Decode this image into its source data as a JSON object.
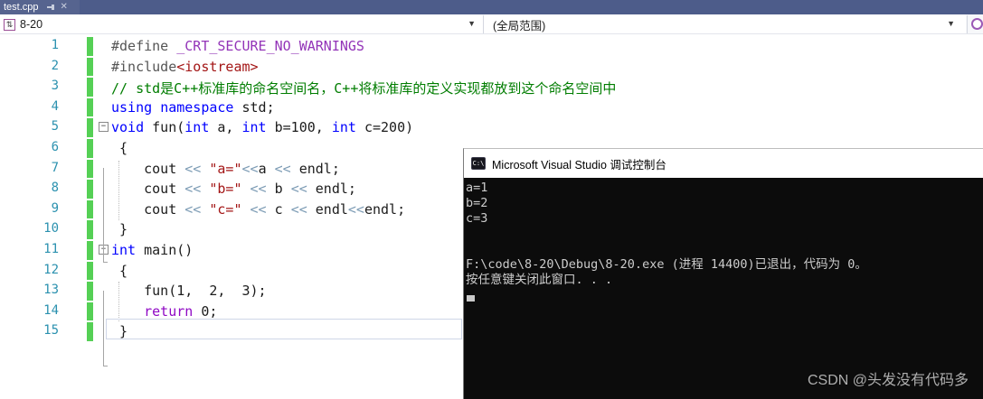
{
  "colors": {
    "tabstrip": "#4d5c8a",
    "tab_active": "#56648f",
    "nav_bg": "#f7f8fa",
    "line_number": "#2b91af",
    "change_bar_green": "#55d055",
    "keyword_blue": "#0000ff",
    "macro_purple": "#9334b8",
    "string_red": "#a31515",
    "comment_green": "#007d00",
    "operator_slate": "#7d9cb5",
    "control_purple": "#8f08c4",
    "console_bg": "#0c0c0c",
    "console_text": "#cccccc"
  },
  "tabstrip": {
    "tab_title": "test.cpp",
    "close_label": "✕"
  },
  "navbar": {
    "project_scope": "8-20",
    "member_scope": "(全局范围)",
    "arrow": "▼"
  },
  "editor": {
    "lines": [
      {
        "num": 1,
        "fold": false,
        "tokens": [
          [
            "d",
            "#define "
          ],
          [
            "m",
            "_CRT_SECURE_NO_WARNINGS"
          ]
        ]
      },
      {
        "num": 2,
        "fold": false,
        "tokens": [
          [
            "d",
            "#include"
          ],
          [
            "s",
            "<iostream>"
          ]
        ]
      },
      {
        "num": 3,
        "fold": false,
        "tokens": [
          [
            "c",
            "// std是C++标准库的命名空间名，C++将标准库的定义实现都放到这个命名空间中"
          ]
        ]
      },
      {
        "num": 4,
        "fold": false,
        "tokens": [
          [
            "k",
            "using"
          ],
          [
            "p",
            " "
          ],
          [
            "k",
            "namespace"
          ],
          [
            "p",
            " std;"
          ]
        ]
      },
      {
        "num": 5,
        "fold": true,
        "tokens": [
          [
            "k",
            "void"
          ],
          [
            "p",
            " fun("
          ],
          [
            "k",
            "int"
          ],
          [
            "p",
            " a, "
          ],
          [
            "k",
            "int"
          ],
          [
            "p",
            " b=100, "
          ],
          [
            "k",
            "int"
          ],
          [
            "p",
            " c=200)"
          ]
        ]
      },
      {
        "num": 6,
        "fold": false,
        "tokens": [
          [
            "p",
            " {"
          ]
        ]
      },
      {
        "num": 7,
        "fold": false,
        "tokens": [
          [
            "p",
            "    cout "
          ],
          [
            "o",
            "<<"
          ],
          [
            "p",
            " "
          ],
          [
            "s",
            "\"a=\""
          ],
          [
            "o",
            "<<"
          ],
          [
            "p",
            "a "
          ],
          [
            "o",
            "<<"
          ],
          [
            "p",
            " endl;"
          ]
        ]
      },
      {
        "num": 8,
        "fold": false,
        "tokens": [
          [
            "p",
            "    cout "
          ],
          [
            "o",
            "<<"
          ],
          [
            "p",
            " "
          ],
          [
            "s",
            "\"b=\""
          ],
          [
            "p",
            " "
          ],
          [
            "o",
            "<<"
          ],
          [
            "p",
            " b "
          ],
          [
            "o",
            "<<"
          ],
          [
            "p",
            " endl;"
          ]
        ]
      },
      {
        "num": 9,
        "fold": false,
        "tokens": [
          [
            "p",
            "    cout "
          ],
          [
            "o",
            "<<"
          ],
          [
            "p",
            " "
          ],
          [
            "s",
            "\"c=\""
          ],
          [
            "p",
            " "
          ],
          [
            "o",
            "<<"
          ],
          [
            "p",
            " c "
          ],
          [
            "o",
            "<<"
          ],
          [
            "p",
            " endl"
          ],
          [
            "o",
            "<<"
          ],
          [
            "p",
            "endl;"
          ]
        ]
      },
      {
        "num": 10,
        "fold": false,
        "tokens": [
          [
            "p",
            " }"
          ]
        ]
      },
      {
        "num": 11,
        "fold": true,
        "tokens": [
          [
            "k",
            "int"
          ],
          [
            "p",
            " main()"
          ]
        ]
      },
      {
        "num": 12,
        "fold": false,
        "tokens": [
          [
            "p",
            " {"
          ]
        ]
      },
      {
        "num": 13,
        "fold": false,
        "tokens": [
          [
            "p",
            "    fun(1,  2,  3);"
          ]
        ]
      },
      {
        "num": 14,
        "fold": false,
        "tokens": [
          [
            "p",
            "    "
          ],
          [
            "r",
            "return"
          ],
          [
            "p",
            " 0;"
          ]
        ]
      },
      {
        "num": 15,
        "fold": false,
        "tokens": [
          [
            "p",
            " }"
          ]
        ]
      }
    ]
  },
  "console": {
    "icon": "C:\\",
    "title": "Microsoft Visual Studio 调试控制台",
    "lines": [
      "a=1",
      "b=2",
      "c=3",
      "",
      "",
      "F:\\code\\8-20\\Debug\\8-20.exe (进程 14400)已退出，代码为 0。",
      "按任意键关闭此窗口. . ."
    ],
    "watermark": "CSDN @头发没有代码多"
  }
}
